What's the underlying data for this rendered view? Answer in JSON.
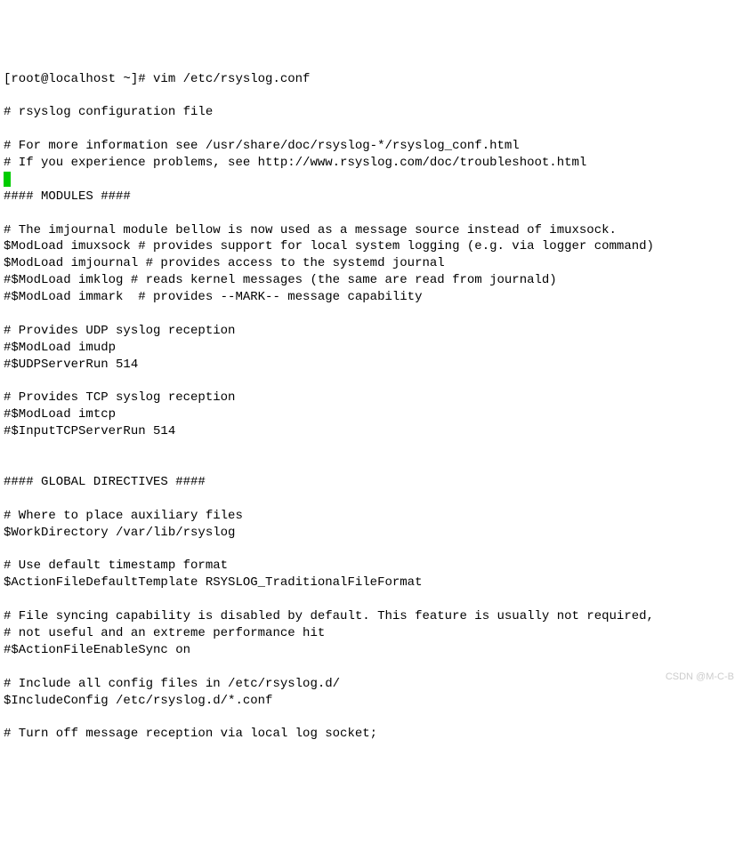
{
  "lines": [
    "[root@localhost ~]# vim /etc/rsyslog.conf",
    "",
    "# rsyslog configuration file",
    "",
    "# For more information see /usr/share/doc/rsyslog-*/rsyslog_conf.html",
    "# If you experience problems, see http://www.rsyslog.com/doc/troubleshoot.html",
    "__CURSOR__",
    "#### MODULES ####",
    "",
    "# The imjournal module bellow is now used as a message source instead of imuxsock.",
    "$ModLoad imuxsock # provides support for local system logging (e.g. via logger command)",
    "$ModLoad imjournal # provides access to the systemd journal",
    "#$ModLoad imklog # reads kernel messages (the same are read from journald)",
    "#$ModLoad immark  # provides --MARK-- message capability",
    "",
    "# Provides UDP syslog reception",
    "#$ModLoad imudp",
    "#$UDPServerRun 514",
    "",
    "# Provides TCP syslog reception",
    "#$ModLoad imtcp",
    "#$InputTCPServerRun 514",
    "",
    "",
    "#### GLOBAL DIRECTIVES ####",
    "",
    "# Where to place auxiliary files",
    "$WorkDirectory /var/lib/rsyslog",
    "",
    "# Use default timestamp format",
    "$ActionFileDefaultTemplate RSYSLOG_TraditionalFileFormat",
    "",
    "# File syncing capability is disabled by default. This feature is usually not required,",
    "# not useful and an extreme performance hit",
    "#$ActionFileEnableSync on",
    "",
    "# Include all config files in /etc/rsyslog.d/",
    "$IncludeConfig /etc/rsyslog.d/*.conf",
    "",
    "# Turn off message reception via local log socket;"
  ],
  "watermark": "CSDN @M-C-B"
}
